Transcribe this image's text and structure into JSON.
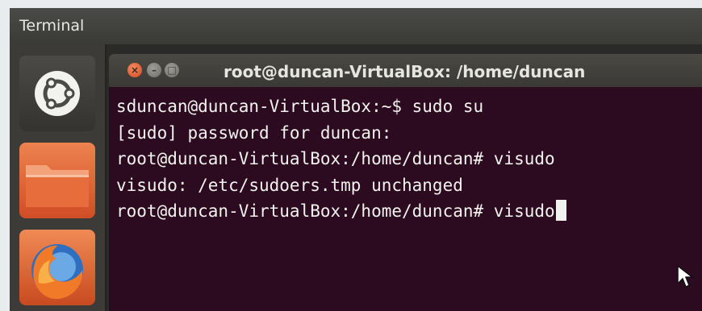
{
  "panel": {
    "title": "Terminal"
  },
  "launcher": {
    "items": [
      {
        "name": "ubuntu-dash",
        "icon": "ubuntu-logo-icon"
      },
      {
        "name": "files",
        "icon": "folder-icon"
      },
      {
        "name": "firefox",
        "icon": "firefox-icon"
      }
    ]
  },
  "window": {
    "title": "root@duncan-VirtualBox: /home/duncan",
    "buttons": {
      "close": "×",
      "minimize": "–",
      "maximize": "□"
    }
  },
  "terminal": {
    "lines": [
      "sduncan@duncan-VirtualBox:~$ sudo su",
      "[sudo] password for duncan:",
      "root@duncan-VirtualBox:/home/duncan# visudo",
      "visudo: /etc/sudoers.tmp unchanged",
      "root@duncan-VirtualBox:/home/duncan# visudo"
    ]
  },
  "colors": {
    "terminal_bg": "#2c0a1f",
    "terminal_fg": "#f2f2ee",
    "close_button": "#e3572b",
    "files_icon": "#e0673a"
  }
}
